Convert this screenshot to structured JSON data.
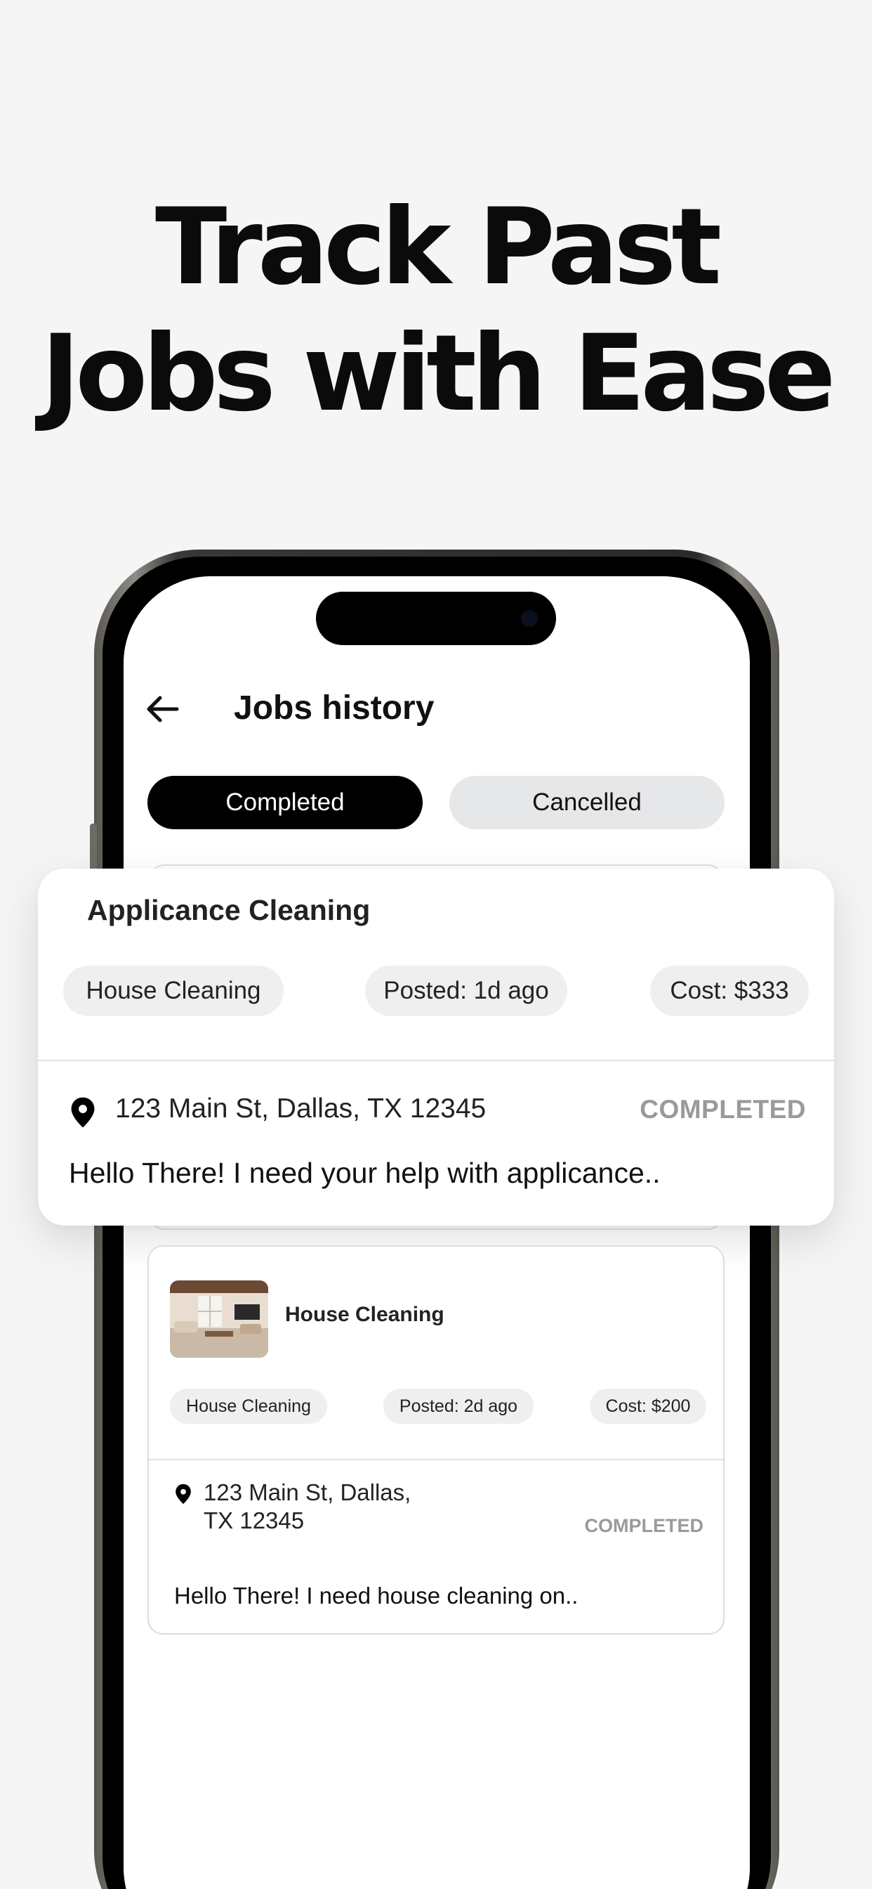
{
  "headline": {
    "line1": "Track Past",
    "line2": "Jobs with Ease"
  },
  "header": {
    "title": "Jobs history"
  },
  "tabs": {
    "completed": "Completed",
    "cancelled": "Cancelled"
  },
  "jobs": [
    {
      "title": "Applicance Cleaning",
      "category": "House Cleaning",
      "posted": "Posted: 1d ago",
      "cost": "Cost: $333",
      "address": "123 Main St, Dallas, TX 12345",
      "status": "COMPLETED",
      "message": "Hello There! I need your help with applicance.."
    },
    {
      "title": "House Cleaning",
      "category": "House Cleaning",
      "posted": "Posted: 2d ago",
      "cost": "Cost: $200",
      "address_line1": "123 Main St, Dallas,",
      "address_line2": "TX 12345",
      "status": "COMPLETED",
      "message": "Hello There! I need house cleaning on.."
    }
  ],
  "colors": {
    "background": "#f5f5f5",
    "tab_active": "#000000",
    "tab_inactive": "#e6e7e9",
    "chip": "#efefef",
    "status_text": "#9a9a9a"
  },
  "icons": {
    "back": "arrow-left-icon",
    "location": "location-pin-icon"
  }
}
